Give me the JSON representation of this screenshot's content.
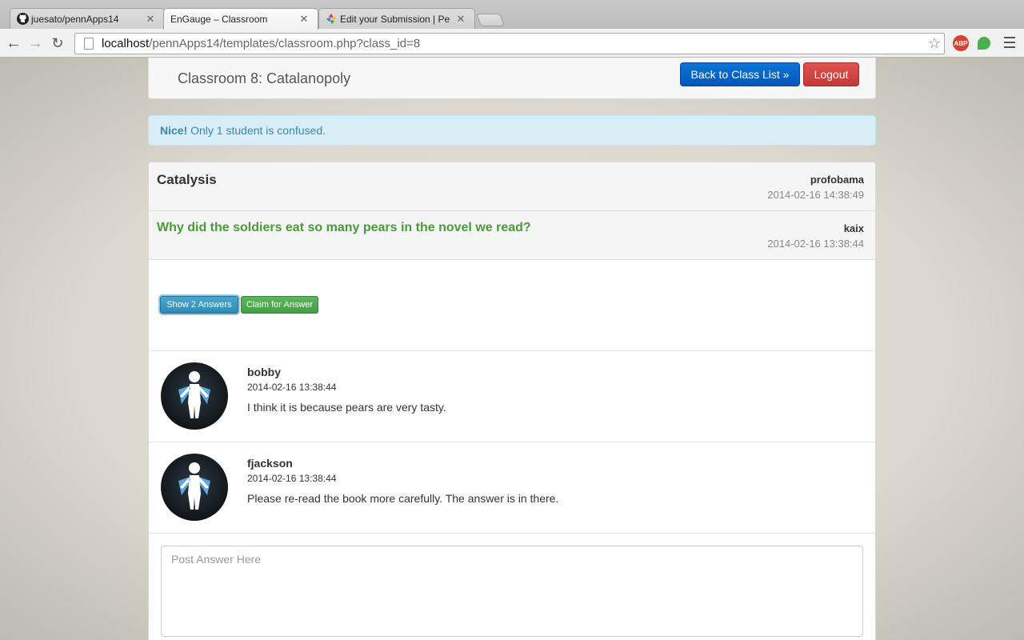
{
  "browser": {
    "tabs": [
      {
        "label": "juesato/pennApps14",
        "icon": "github-icon",
        "active": false
      },
      {
        "label": "EnGauge – Classroom",
        "icon": "none",
        "active": true
      },
      {
        "label": "Edit your Submission | Pen",
        "icon": "colorful-logo-icon",
        "active": false
      }
    ],
    "url_host": "localhost",
    "url_path": "/pennApps14/templates/classroom.php?class_id=8",
    "extensions": [
      {
        "name": "adblock-plus-icon",
        "label": "ABP",
        "color": "#d9412f"
      },
      {
        "name": "evernote-icon",
        "label": "",
        "color": "#4caf50"
      }
    ]
  },
  "header": {
    "title": "Classroom 8: Catalanopoly",
    "back_label": "Back to Class List »",
    "logout_label": "Logout"
  },
  "alert": {
    "strong": "Nice!",
    "text": " Only 1 student is confused."
  },
  "topic": {
    "title": "Catalysis",
    "author": "profobama",
    "timestamp": "2014-02-16 14:38:49"
  },
  "question": {
    "text": "Why did the soldiers eat so many pears in the novel we read?",
    "author": "kaix",
    "timestamp": "2014-02-16 13:38:44"
  },
  "actions": {
    "show_answers_label": "Show 2 Answers",
    "claim_label": "Claim for Answer"
  },
  "answers": [
    {
      "user": "bobby",
      "date": "2014-02-16 13:38:44",
      "text": "I think it is because pears are very tasty."
    },
    {
      "user": "fjackson",
      "date": "2014-02-16 13:38:44",
      "text": "Please re-read the book more carefully. The answer is in there."
    }
  ],
  "reply": {
    "placeholder": "Post Answer Here"
  },
  "colors": {
    "question_green": "#4a9a3c",
    "alert_blue": "#3a87ad",
    "primary": "#0556b8",
    "danger": "#c23a36"
  }
}
